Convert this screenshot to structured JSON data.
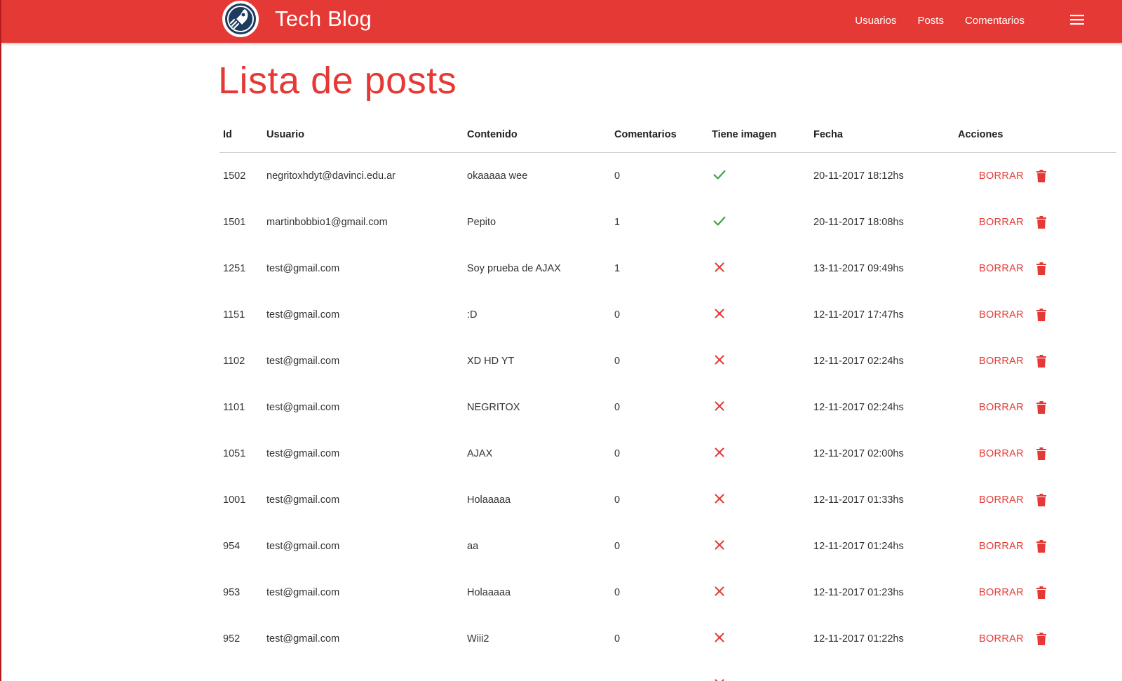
{
  "brand": {
    "title": "Tech Blog",
    "logo_icon": "rocket-logo-icon"
  },
  "nav": {
    "links": [
      {
        "label": "Usuarios"
      },
      {
        "label": "Posts"
      },
      {
        "label": "Comentarios"
      }
    ],
    "menu_icon": "hamburger-menu-icon"
  },
  "page": {
    "title": "Lista de posts"
  },
  "colors": {
    "primary": "#e53935",
    "success": "#43a047",
    "danger": "#e53935"
  },
  "table": {
    "headers": [
      "Id",
      "Usuario",
      "Contenido",
      "Comentarios",
      "Tiene imagen",
      "Fecha",
      "Acciones"
    ],
    "delete_label": "BORRAR",
    "rows": [
      {
        "id": "1502",
        "user": "negritoxhdyt@davinci.edu.ar",
        "content": "okaaaaa wee",
        "comments": "0",
        "has_image": true,
        "date": "20-11-2017 18:12hs"
      },
      {
        "id": "1501",
        "user": "martinbobbio1@gmail.com",
        "content": "Pepito",
        "comments": "1",
        "has_image": true,
        "date": "20-11-2017 18:08hs"
      },
      {
        "id": "1251",
        "user": "test@gmail.com",
        "content": "Soy prueba de AJAX",
        "comments": "1",
        "has_image": false,
        "date": "13-11-2017 09:49hs"
      },
      {
        "id": "1151",
        "user": "test@gmail.com",
        "content": ":D",
        "comments": "0",
        "has_image": false,
        "date": "12-11-2017 17:47hs"
      },
      {
        "id": "1102",
        "user": "test@gmail.com",
        "content": "XD HD YT",
        "comments": "0",
        "has_image": false,
        "date": "12-11-2017 02:24hs"
      },
      {
        "id": "1101",
        "user": "test@gmail.com",
        "content": "NEGRITOX",
        "comments": "0",
        "has_image": false,
        "date": "12-11-2017 02:24hs"
      },
      {
        "id": "1051",
        "user": "test@gmail.com",
        "content": "AJAX",
        "comments": "0",
        "has_image": false,
        "date": "12-11-2017 02:00hs"
      },
      {
        "id": "1001",
        "user": "test@gmail.com",
        "content": "Holaaaaa",
        "comments": "0",
        "has_image": false,
        "date": "12-11-2017 01:33hs"
      },
      {
        "id": "954",
        "user": "test@gmail.com",
        "content": "aa",
        "comments": "0",
        "has_image": false,
        "date": "12-11-2017 01:24hs"
      },
      {
        "id": "953",
        "user": "test@gmail.com",
        "content": "Holaaaaa",
        "comments": "0",
        "has_image": false,
        "date": "12-11-2017 01:23hs"
      },
      {
        "id": "952",
        "user": "test@gmail.com",
        "content": "Wiii2",
        "comments": "0",
        "has_image": false,
        "date": "12-11-2017 01:22hs"
      },
      {
        "id": "",
        "user": "",
        "content": "",
        "comments": "",
        "has_image": false,
        "date": ""
      }
    ]
  }
}
